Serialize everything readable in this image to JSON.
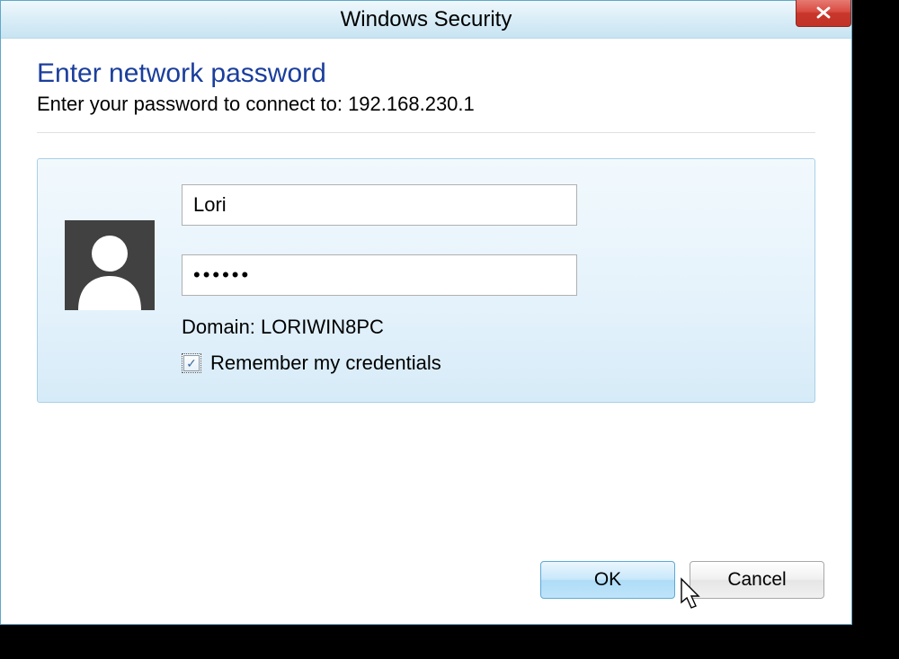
{
  "window": {
    "title": "Windows Security"
  },
  "dialog": {
    "heading": "Enter network password",
    "subheading": "Enter your password to connect to: 192.168.230.1"
  },
  "credentials": {
    "username": "Lori",
    "password": "••••••",
    "domain_label": "Domain: LORIWIN8PC",
    "remember_label": "Remember my credentials",
    "remember_checked": true
  },
  "buttons": {
    "ok": "OK",
    "cancel": "Cancel"
  }
}
